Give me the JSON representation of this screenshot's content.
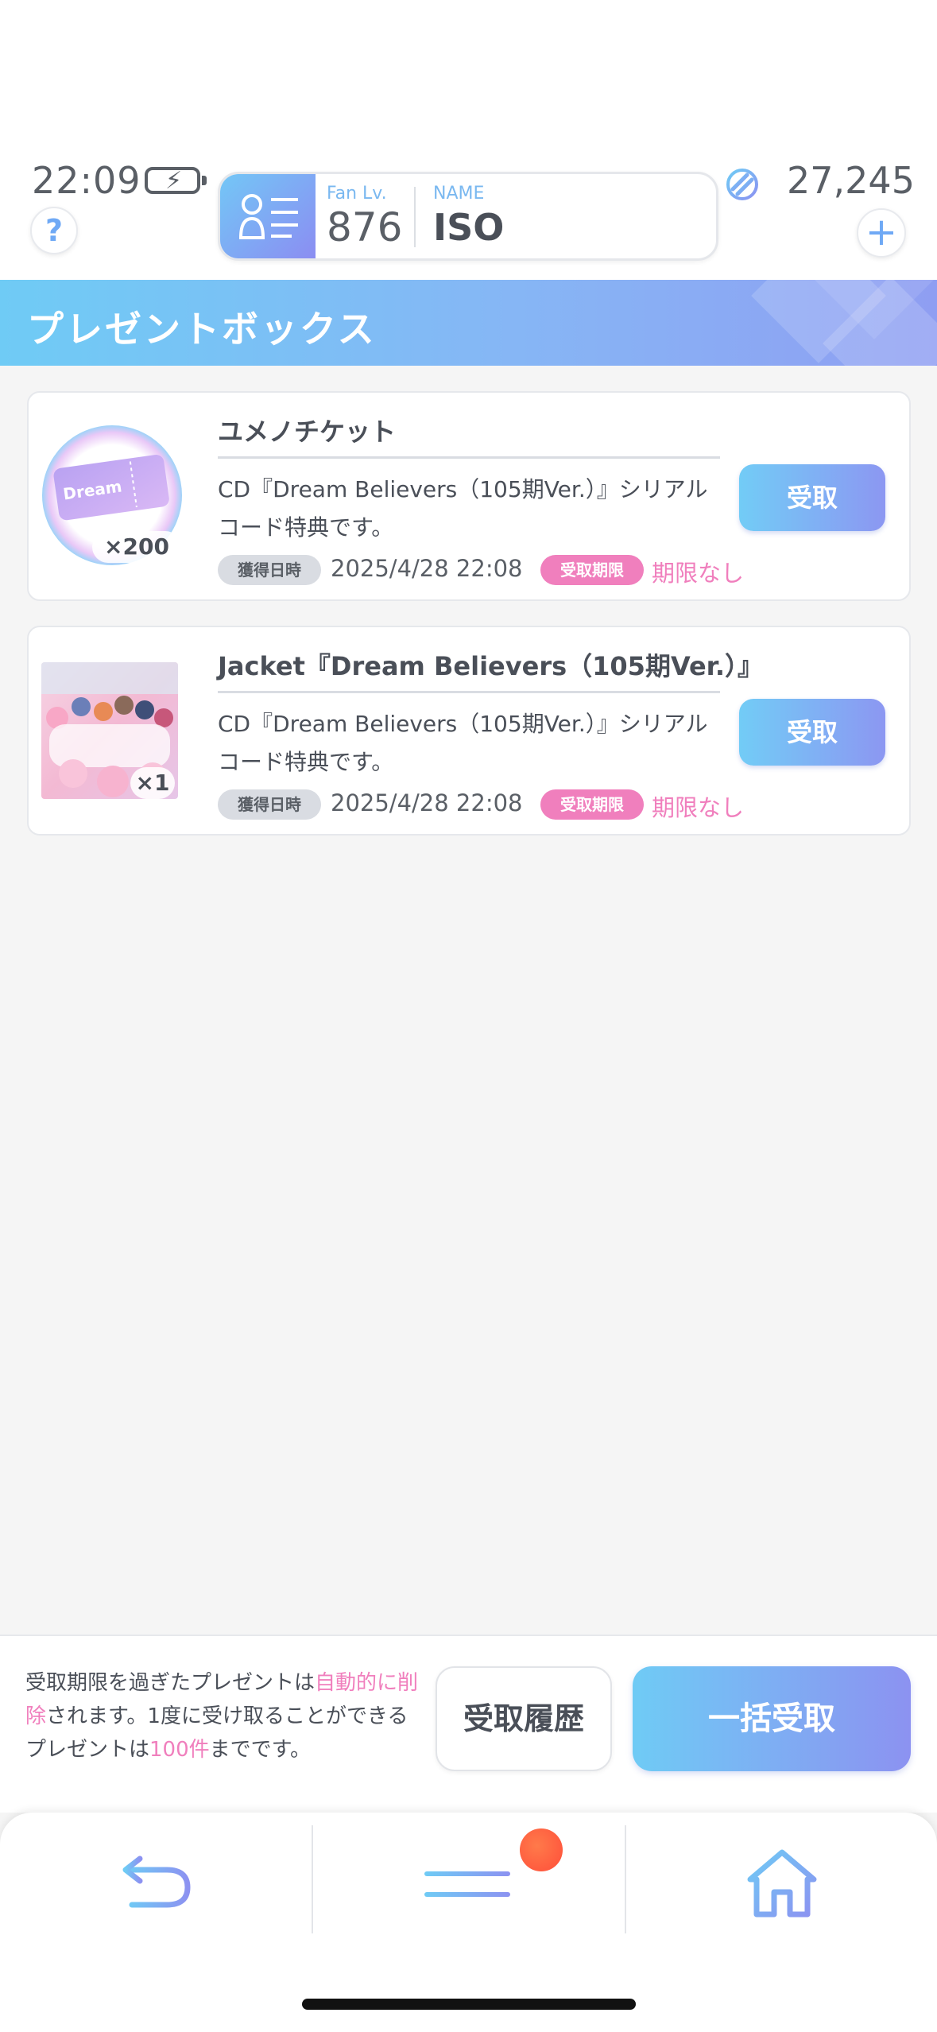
{
  "status_bar": {
    "time": "22:09"
  },
  "profile": {
    "fan_level_label": "Fan Lv.",
    "fan_level_value": "876",
    "name_label": "NAME",
    "name_value": "ISO"
  },
  "currency": {
    "value": "27,245",
    "add_label": "+"
  },
  "help": {
    "label": "?"
  },
  "banner": {
    "title": "プレゼントボックス"
  },
  "labels": {
    "acquired_tag": "獲得日時",
    "limit_tag": "受取期限",
    "no_limit": "期限なし",
    "claim": "受取"
  },
  "items": [
    {
      "title": "ユメノチケット",
      "description": "CD『Dream Believers（105期Ver.）』シリアルコード特典です。",
      "acquired": "2025/4/28 22:08",
      "quantity": "×200",
      "ticket_text": "Dream"
    },
    {
      "title": "Jacket『Dream Believers（105期Ver.）』",
      "description": "CD『Dream Believers（105期Ver.）』シリアルコード特典です。",
      "acquired": "2025/4/28 22:08",
      "quantity": "×1"
    }
  ],
  "footer": {
    "notice_1": "受取期限を過ぎたプレゼントは",
    "notice_2": "自動的に削除",
    "notice_3": "されます。1度に受け取ることができるプレゼントは",
    "notice_4": "100件",
    "notice_5": "までです。",
    "history_label": "受取履歴",
    "claim_all_label": "一括受取"
  },
  "colors": {
    "accent_blue": "#6fcbf5",
    "accent_purple": "#8c92f1",
    "pink": "#f07fbd",
    "notification": "#ff5a3c"
  }
}
